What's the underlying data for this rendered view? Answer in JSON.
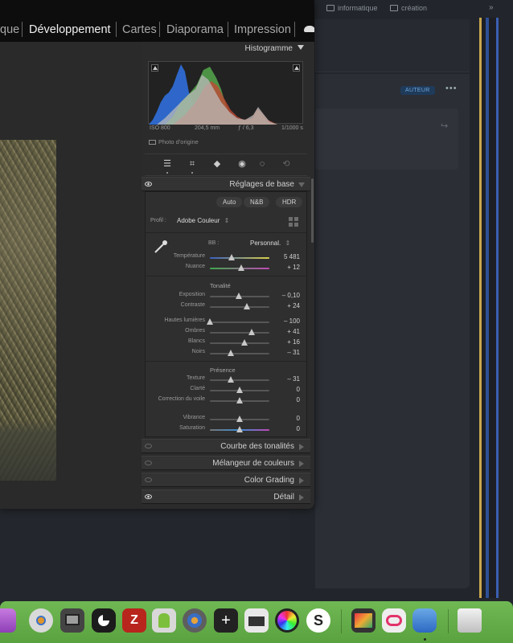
{
  "background_browser": {
    "bookmarks": [
      {
        "label": "informatique",
        "icon": "folder-icon"
      },
      {
        "label": "création",
        "icon": "folder-icon"
      }
    ],
    "overflow": "»",
    "author_badge": "AUTEUR",
    "more": "•••",
    "share": "↪"
  },
  "lightroom": {
    "modules": [
      {
        "label": "que",
        "active": false
      },
      {
        "label": "Développement",
        "active": true
      },
      {
        "label": "Cartes",
        "active": false
      },
      {
        "label": "Diaporama",
        "active": false
      },
      {
        "label": "Impression",
        "active": false
      }
    ],
    "histogram": {
      "title": "Histogramme",
      "exif": {
        "iso": "ISO 800",
        "focal": "204,5 mm",
        "aperture": "ƒ / 6,3",
        "shutter": "1/1000 s"
      },
      "original_photo": "Photo d'origine"
    },
    "tools": [
      "sliders-icon",
      "crop-icon",
      "eraser-icon",
      "redeye-icon",
      "mask-icon",
      "history-icon"
    ],
    "basic": {
      "title": "Réglages de base",
      "treatment": [
        "Auto",
        "N&B",
        "HDR"
      ],
      "profile_label": "Profil :",
      "profile_value": "Adobe Couleur",
      "wb_label": "BB :",
      "wb_value": "Personnal.",
      "wb_sliders": [
        {
          "label": "Température",
          "value": "5 481",
          "pos": 0.37
        },
        {
          "label": "Nuance",
          "value": "+ 12",
          "pos": 0.53
        }
      ],
      "tone_title": "Tonalité",
      "tone_sliders": [
        {
          "label": "Exposition",
          "value": "– 0,10",
          "pos": 0.49
        },
        {
          "label": "Contraste",
          "value": "+ 24",
          "pos": 0.62
        }
      ],
      "tone_sliders2": [
        {
          "label": "Hautes lumières",
          "value": "– 100",
          "pos": 0.0
        },
        {
          "label": "Ombres",
          "value": "+ 41",
          "pos": 0.7
        },
        {
          "label": "Blancs",
          "value": "+ 16",
          "pos": 0.58
        },
        {
          "label": "Noirs",
          "value": "– 31",
          "pos": 0.35
        }
      ],
      "presence_title": "Présence",
      "presence_sliders": [
        {
          "label": "Texture",
          "value": "– 31",
          "pos": 0.35
        },
        {
          "label": "Clarté",
          "value": "0",
          "pos": 0.5
        },
        {
          "label": "Correction du voile",
          "value": "0",
          "pos": 0.5
        }
      ],
      "presence_sliders2": [
        {
          "label": "Vibrance",
          "value": "0",
          "pos": 0.5
        },
        {
          "label": "Saturation",
          "value": "0",
          "pos": 0.5
        }
      ]
    },
    "collapsed_panels": [
      {
        "title": "Courbe des tonalités",
        "eye_on": false
      },
      {
        "title": "Mélangeur de couleurs",
        "eye_on": false
      },
      {
        "title": "Color Grading",
        "eye_on": false
      },
      {
        "title": "Détail",
        "eye_on": true
      }
    ]
  },
  "dock": {
    "apps": [
      "monitor-app-icon",
      "compass-app-icon",
      "console-app-icon",
      "dark-app-icon",
      "filezilla-app-icon",
      "android-app-icon",
      "globe-app-icon",
      "plus-app-icon",
      "printer-app-icon",
      "color-wheel-app-icon",
      "s-app-icon",
      "photo-app-icon",
      "creative-cloud-app-icon",
      "bucket-app-icon",
      "trash-icon"
    ]
  }
}
